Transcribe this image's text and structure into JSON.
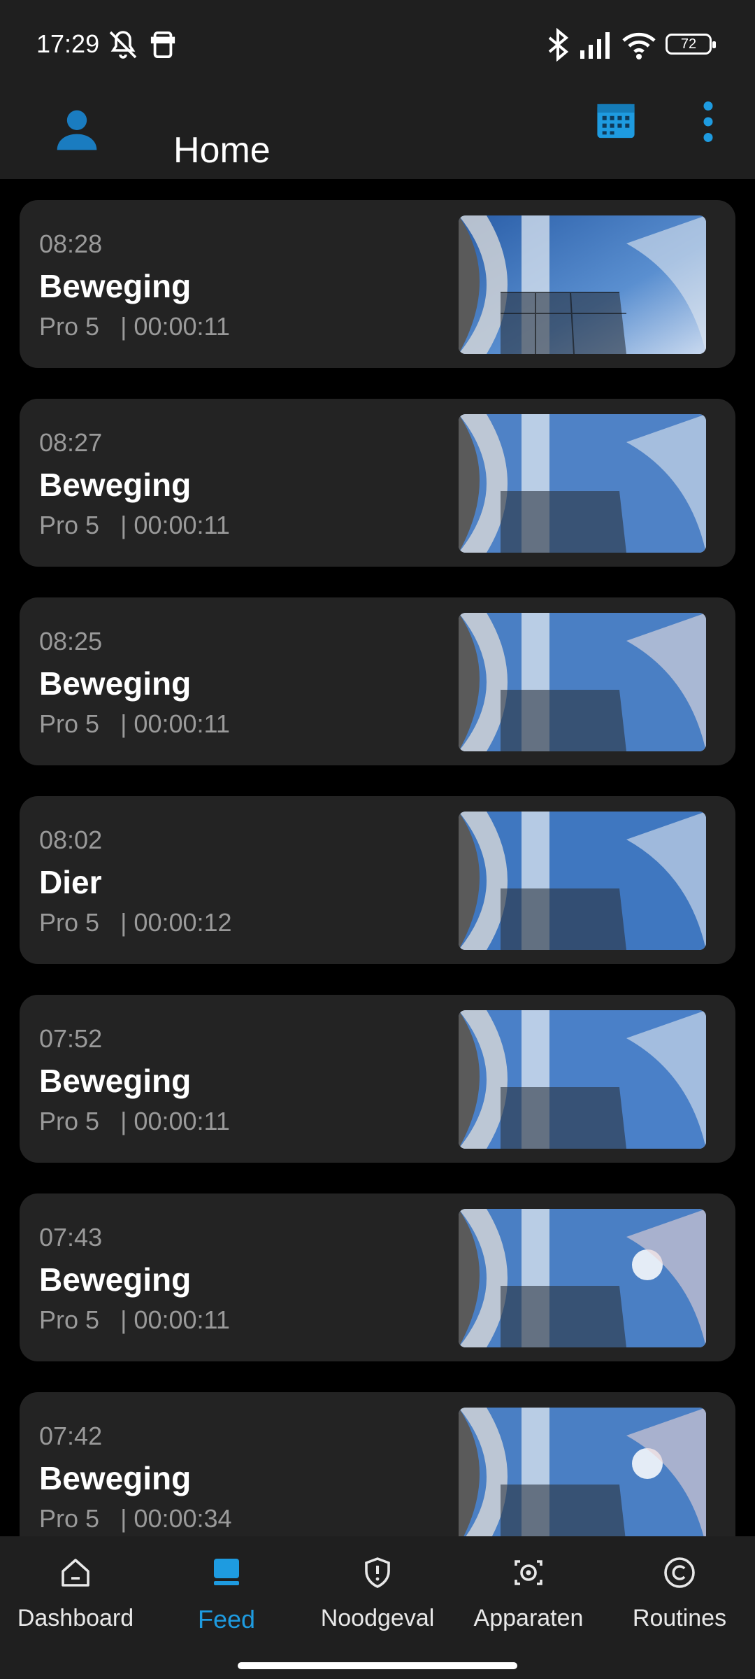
{
  "status_bar": {
    "time": "17:29",
    "battery": "72",
    "icons": [
      "bell-off-icon",
      "phone-icon",
      "bluetooth-icon",
      "signal-icon",
      "wifi-icon",
      "battery-icon"
    ]
  },
  "app_bar": {
    "title": "Home",
    "icons": [
      "profile-icon",
      "calendar-icon",
      "more-vert-icon"
    ],
    "accent": "#1e9be0"
  },
  "feed": {
    "events": [
      {
        "time": "08:28",
        "type": "Beweging",
        "device": "Pro 5",
        "duration": "| 00:00:11"
      },
      {
        "time": "08:27",
        "type": "Beweging",
        "device": "Pro 5",
        "duration": "| 00:00:11"
      },
      {
        "time": "08:25",
        "type": "Beweging",
        "device": "Pro 5",
        "duration": "| 00:00:11"
      },
      {
        "time": "08:02",
        "type": "Dier",
        "device": "Pro 5",
        "duration": "| 00:00:12"
      },
      {
        "time": "07:52",
        "type": "Beweging",
        "device": "Pro 5",
        "duration": "| 00:00:11"
      },
      {
        "time": "07:43",
        "type": "Beweging",
        "device": "Pro 5",
        "duration": "| 00:00:11"
      },
      {
        "time": "07:42",
        "type": "Beweging",
        "device": "Pro 5",
        "duration": "| 00:00:34"
      }
    ]
  },
  "bottom_nav": {
    "items": [
      {
        "label": "Dashboard",
        "icon": "home-icon"
      },
      {
        "label": "Feed",
        "icon": "feed-icon",
        "active": true
      },
      {
        "label": "Noodgeval",
        "icon": "shield-alert-icon"
      },
      {
        "label": "Apparaten",
        "icon": "camera-icon"
      },
      {
        "label": "Routines",
        "icon": "routine-icon"
      }
    ]
  }
}
